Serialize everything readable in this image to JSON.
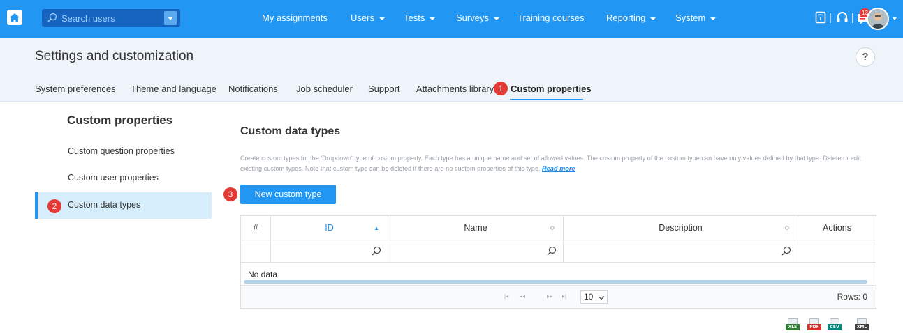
{
  "topbar": {
    "search_placeholder": "Search users",
    "menu": [
      {
        "label": "My assignments",
        "caret": false
      },
      {
        "label": "Users",
        "caret": true
      },
      {
        "label": "Tests",
        "caret": true
      },
      {
        "label": "Surveys",
        "caret": true
      },
      {
        "label": "Training courses",
        "caret": false
      },
      {
        "label": "Reporting",
        "caret": true
      },
      {
        "label": "System",
        "caret": true
      }
    ],
    "notification_count": "13",
    "colors": {
      "bar": "#2196f3",
      "search": "#1565c0"
    }
  },
  "header": {
    "title": "Settings and customization",
    "help": "?",
    "tabs": [
      {
        "label": "System preferences"
      },
      {
        "label": "Theme and language"
      },
      {
        "label": "Notifications"
      },
      {
        "label": "Job scheduler"
      },
      {
        "label": "Support"
      },
      {
        "label": "Attachments library"
      },
      {
        "label": "Custom properties",
        "active": true
      }
    ]
  },
  "steps": {
    "one": "1",
    "two": "2",
    "three": "3"
  },
  "sidebar": {
    "title": "Custom properties",
    "items": [
      {
        "label": "Custom question properties"
      },
      {
        "label": "Custom user properties"
      },
      {
        "label": "Custom data types",
        "active": true
      }
    ]
  },
  "main": {
    "title": "Custom data types",
    "description": "Create custom types for the 'Dropdown' type of custom property. Each type has a unique name and set of allowed values. The custom property of the custom type can have only values defined by that type. Delete or edit existing custom types. Note that custom type can be deleted if there are no custom properties of this type.",
    "read_more": "Read more",
    "new_button": "New custom type",
    "grid": {
      "columns": [
        {
          "label": "#"
        },
        {
          "label": "ID"
        },
        {
          "label": "Name"
        },
        {
          "label": "Description"
        },
        {
          "label": "Actions"
        }
      ],
      "empty_text": "No data",
      "page_size": "10",
      "rows_label": "Rows: 0"
    },
    "exports": [
      "XLS",
      "PDF",
      "CSV",
      "XML"
    ]
  },
  "colors": {
    "accent": "#2196f3",
    "step_badge": "#e53935",
    "active_side": "#d6eefb"
  }
}
